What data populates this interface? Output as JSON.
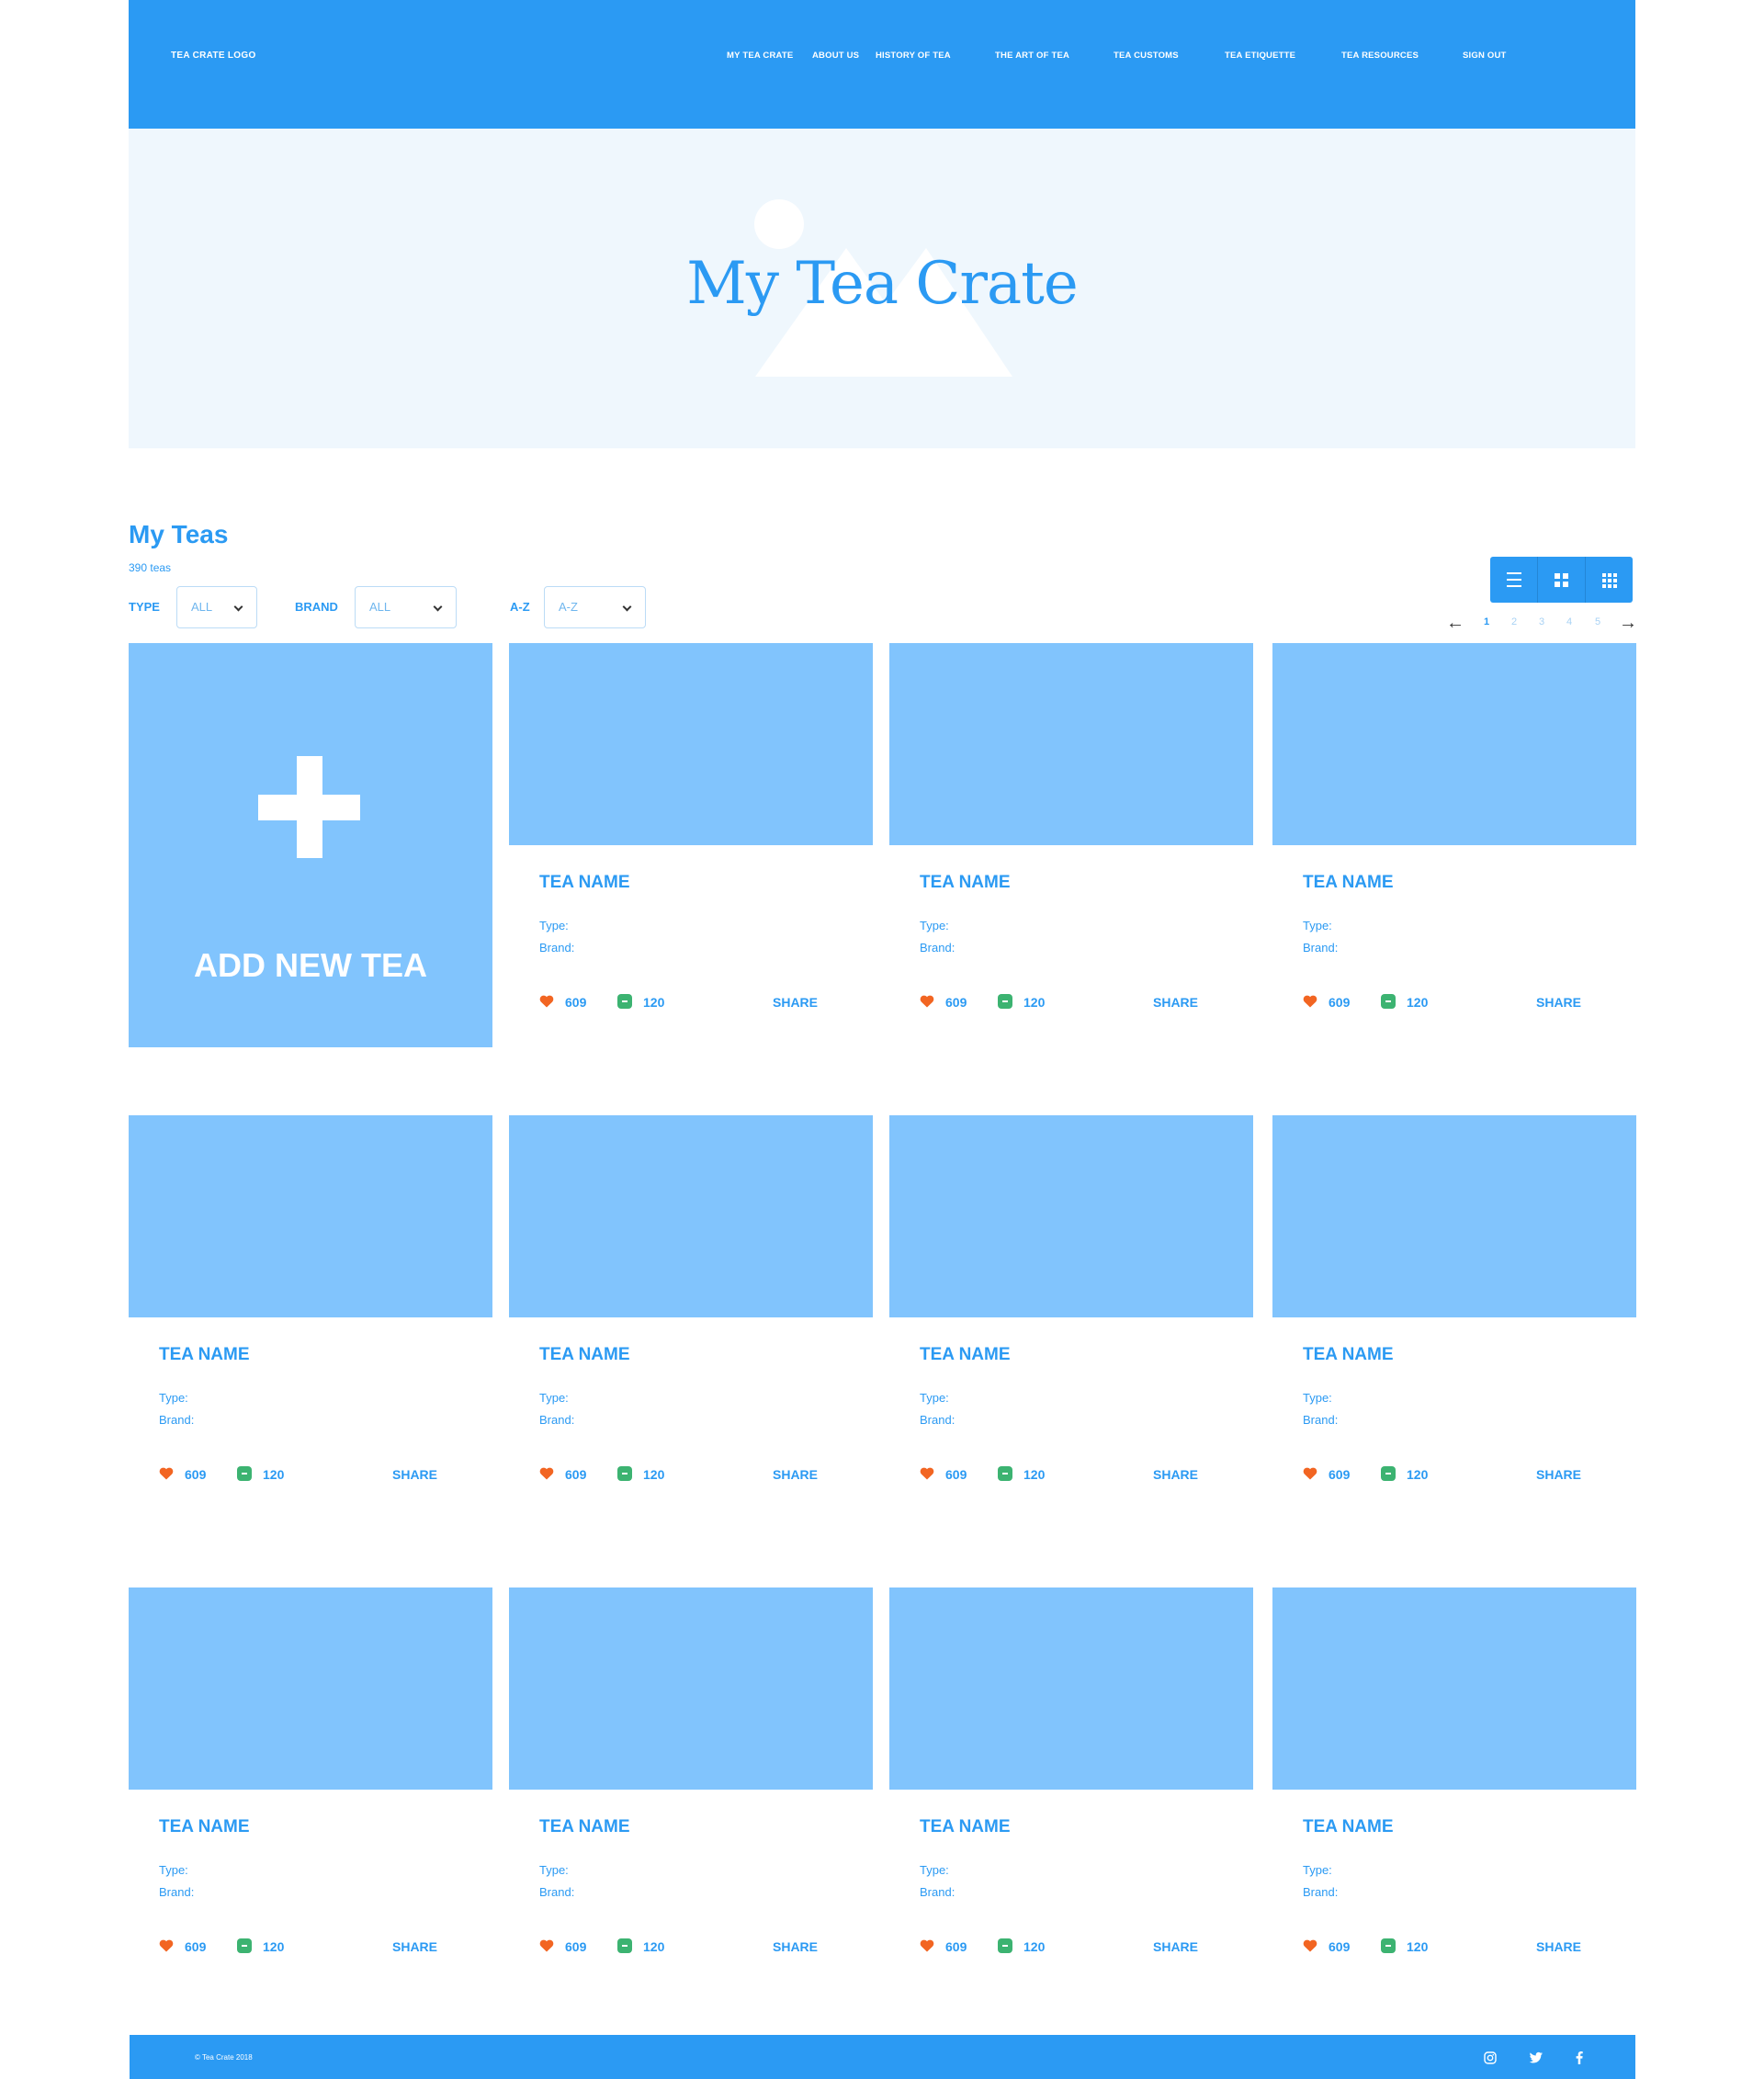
{
  "header": {
    "logo": "TEA CRATE LOGO",
    "nav": [
      "MY TEA CRATE",
      "ABOUT US",
      "HISTORY OF TEA",
      "THE ART OF TEA",
      "TEA CUSTOMS",
      "TEA ETIQUETTE",
      "TEA RESOURCES",
      "SIGN OUT"
    ]
  },
  "hero": {
    "title": "My Tea Crate"
  },
  "section": {
    "title": "My Teas",
    "count": "390 teas"
  },
  "filters": {
    "type": {
      "label": "TYPE",
      "value": "ALL"
    },
    "brand": {
      "label": "BRAND",
      "value": "ALL"
    },
    "sort": {
      "label": "A-Z",
      "value": "A-Z"
    }
  },
  "view_modes": [
    "list-icon",
    "grid-large-icon",
    "grid-small-icon"
  ],
  "pagination": {
    "pages": [
      "1",
      "2",
      "3",
      "4",
      "5"
    ],
    "current": "1"
  },
  "add_card": {
    "label": "ADD NEW TEA"
  },
  "card_template": {
    "name": "TEA NAME",
    "type_label": "Type:",
    "brand_label": "Brand:",
    "likes": "609",
    "comments": "120",
    "share": "SHARE"
  },
  "cards": [
    {
      "name": "TEA NAME",
      "type_label": "Type:",
      "brand_label": "Brand:",
      "likes": "609",
      "comments": "120",
      "share": "SHARE"
    },
    {
      "name": "TEA NAME",
      "type_label": "Type:",
      "brand_label": "Brand:",
      "likes": "609",
      "comments": "120",
      "share": "SHARE"
    },
    {
      "name": "TEA NAME",
      "type_label": "Type:",
      "brand_label": "Brand:",
      "likes": "609",
      "comments": "120",
      "share": "SHARE"
    },
    {
      "name": "TEA NAME",
      "type_label": "Type:",
      "brand_label": "Brand:",
      "likes": "609",
      "comments": "120",
      "share": "SHARE"
    },
    {
      "name": "TEA NAME",
      "type_label": "Type:",
      "brand_label": "Brand:",
      "likes": "609",
      "comments": "120",
      "share": "SHARE"
    },
    {
      "name": "TEA NAME",
      "type_label": "Type:",
      "brand_label": "Brand:",
      "likes": "609",
      "comments": "120",
      "share": "SHARE"
    },
    {
      "name": "TEA NAME",
      "type_label": "Type:",
      "brand_label": "Brand:",
      "likes": "609",
      "comments": "120",
      "share": "SHARE"
    },
    {
      "name": "TEA NAME",
      "type_label": "Type:",
      "brand_label": "Brand:",
      "likes": "609",
      "comments": "120",
      "share": "SHARE"
    },
    {
      "name": "TEA NAME",
      "type_label": "Type:",
      "brand_label": "Brand:",
      "likes": "609",
      "comments": "120",
      "share": "SHARE"
    },
    {
      "name": "TEA NAME",
      "type_label": "Type:",
      "brand_label": "Brand:",
      "likes": "609",
      "comments": "120",
      "share": "SHARE"
    },
    {
      "name": "TEA NAME",
      "type_label": "Type:",
      "brand_label": "Brand:",
      "likes": "609",
      "comments": "120",
      "share": "SHARE"
    }
  ],
  "footer": {
    "copyright": "© Tea Crate 2018",
    "social": [
      "instagram-icon",
      "twitter-icon",
      "facebook-icon"
    ]
  },
  "colors": {
    "primary": "#2b9af3",
    "card_image": "#81c4fd",
    "hero_bg": "#eff7fd",
    "heart": "#f26522",
    "comment": "#3cb371"
  }
}
